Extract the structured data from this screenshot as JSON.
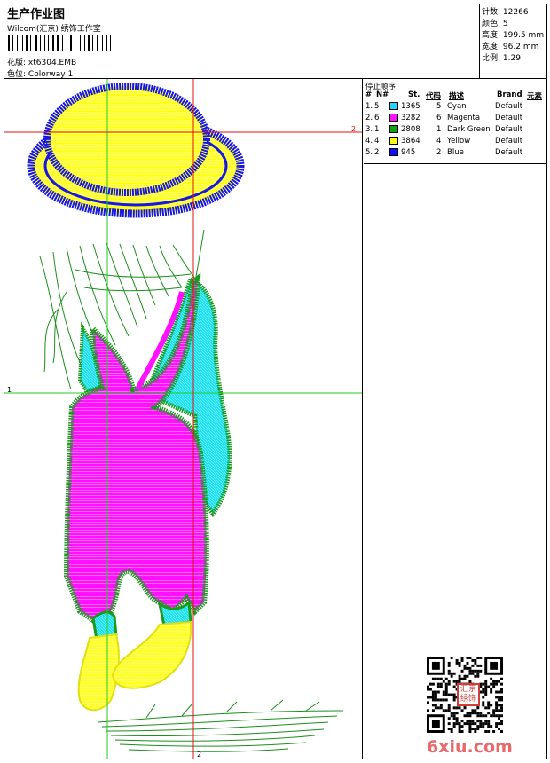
{
  "header": {
    "title": "生产作业图",
    "company": "Wilcom(汇京) 绣饰工作室",
    "design_label": "花版:",
    "design_value": "xt6304.EMB",
    "colorway_label": "色位:",
    "colorway_value": "Colorway 1"
  },
  "stats": {
    "stitches_label": "针数:",
    "stitches_value": "12266",
    "colors_label": "颜色:",
    "colors_value": "5",
    "height_label": "高度:",
    "height_value": "199.5 mm",
    "width_label": "宽度:",
    "width_value": "96.2 mm",
    "scale_label": "比例:",
    "scale_value": "1.29"
  },
  "guides": {
    "horizontal_1": "1",
    "horizontal_2": "2",
    "vertical_2": "2"
  },
  "sequence": {
    "title": "停止顺序:",
    "headers": [
      "#",
      "N#",
      "St.",
      "代码",
      "描述",
      "Brand",
      "元素"
    ],
    "rows": [
      {
        "n": "1.",
        "nn": "5",
        "st": "1365",
        "code": "5",
        "desc": "Cyan",
        "brand": "Default",
        "color": "#1fd6ff"
      },
      {
        "n": "2.",
        "nn": "6",
        "st": "3282",
        "code": "6",
        "desc": "Magenta",
        "brand": "Default",
        "color": "#ff10ff"
      },
      {
        "n": "3.",
        "nn": "1",
        "st": "2808",
        "code": "1",
        "desc": "Dark Green",
        "brand": "Default",
        "color": "#10a010"
      },
      {
        "n": "4.",
        "nn": "4",
        "st": "3864",
        "code": "4",
        "desc": "Yellow",
        "brand": "Default",
        "color": "#ffff10"
      },
      {
        "n": "5.",
        "nn": "2",
        "st": "945",
        "code": "2",
        "desc": "Blue",
        "brand": "Default",
        "color": "#1010ff"
      }
    ]
  },
  "seal": {
    "line1": "汇京",
    "line2": "绣饰"
  },
  "watermark": "6xiu.com",
  "icons": {
    "barcode": "barcode-icon",
    "qr": "qr-code-icon",
    "seal": "seal-icon"
  },
  "colors": {
    "guide_red": "#e01010",
    "guide_green": "#22cc22"
  }
}
